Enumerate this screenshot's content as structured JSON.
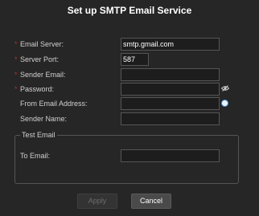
{
  "dialog": {
    "title": "Set up SMTP Email Service",
    "required_marker": "*",
    "fields": {
      "email_server": {
        "label": "Email Server:",
        "value": "smtp.gmail.com"
      },
      "server_port": {
        "label": "Server Port:",
        "value": "587"
      },
      "sender_email": {
        "label": "Sender Email:",
        "value": ""
      },
      "password": {
        "label": "Password:",
        "value": "",
        "icon": "eye-icon"
      },
      "from_address": {
        "label": "From Email Address:",
        "value": "",
        "icon": "info-dot-icon"
      },
      "sender_name": {
        "label": "Sender Name:",
        "value": ""
      }
    },
    "test_group": {
      "title": "Test Email",
      "to_email": {
        "label": "To Email:",
        "value": ""
      }
    },
    "buttons": {
      "apply": "Apply",
      "cancel": "Cancel"
    },
    "colors": {
      "background": "#262626",
      "required": "#b03030",
      "input_bg": "#1d1d1d",
      "accent": "#4a8fd9"
    }
  }
}
